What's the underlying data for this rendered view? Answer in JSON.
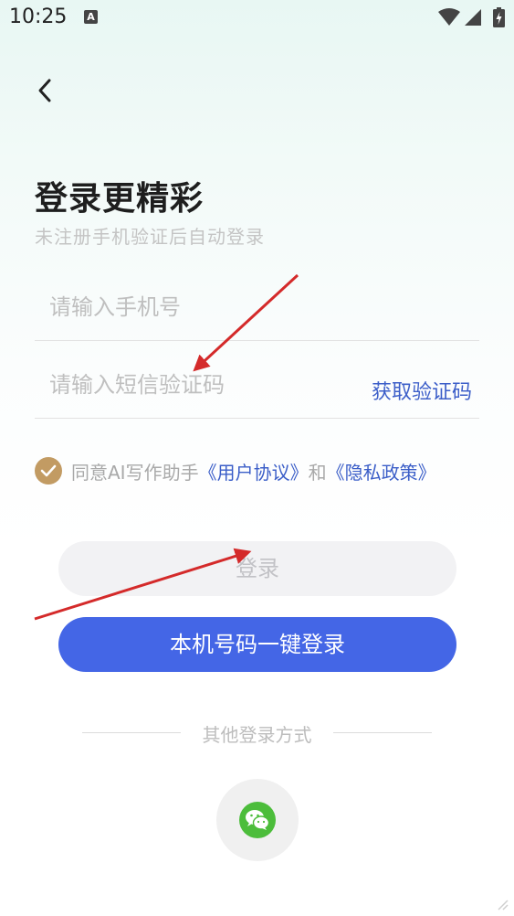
{
  "status_bar": {
    "time": "10:25",
    "notification_glyph": "A"
  },
  "header": {
    "back_icon": "chevron-left-icon"
  },
  "title": "登录更精彩",
  "subtitle": "未注册手机验证后自动登录",
  "phone_field": {
    "value": "",
    "placeholder": "请输入手机号"
  },
  "code_field": {
    "value": "",
    "placeholder": "请输入短信验证码",
    "get_code_label": "获取验证码"
  },
  "agreement": {
    "checked": true,
    "prefix": "同意AI写作助手",
    "user_agreement": "《用户协议》",
    "conjunction": "和",
    "privacy_policy": "《隐私政策》"
  },
  "buttons": {
    "login_label": "登录",
    "one_key_login_label": "本机号码一键登录"
  },
  "other_login": {
    "label": "其他登录方式",
    "wechat_icon": "wechat-icon"
  },
  "colors": {
    "accent": "#4466e6",
    "link": "#3b5ec8",
    "check": "#c29b63",
    "wechat": "#4cbd3b",
    "annotation_arrow": "#d42a2a"
  }
}
